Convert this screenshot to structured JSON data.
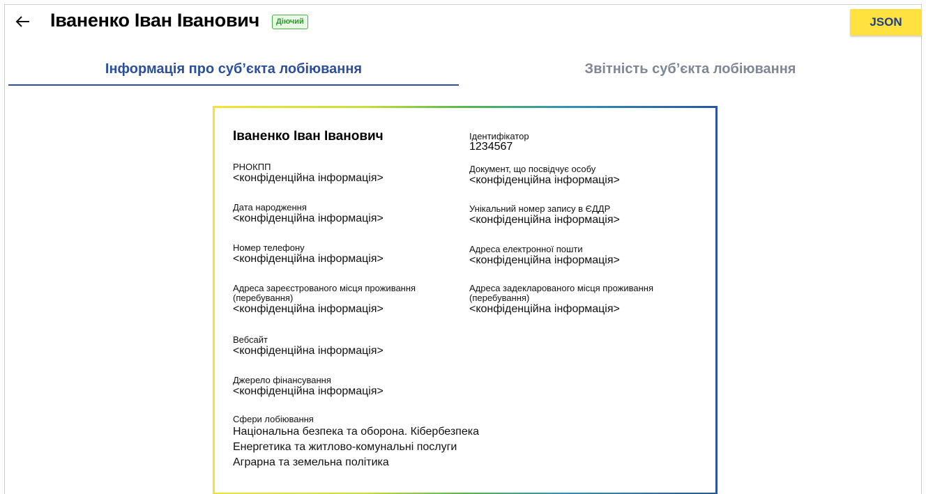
{
  "header": {
    "back_icon": "arrow-left-icon",
    "title": "Іваненко Іван Іванович",
    "status_badge": "Діючий",
    "json_button": "JSON"
  },
  "tabs": [
    {
      "label": "Інформація про суб’єкта лобіювання",
      "active": true
    },
    {
      "label": "Звітність суб’єкта лобіювання",
      "active": false
    }
  ],
  "colors": {
    "accent_blue": "#2b4f9e",
    "badge_green": "#46b33f",
    "json_button_bg": "#ffe23f",
    "inactive_tab": "#7d8795"
  },
  "card": {
    "name": "Іваненко Іван Іванович",
    "left_fields": [
      {
        "label": "РНОКПП",
        "value": "<конфіденційна інформація>"
      },
      {
        "label": "Дата народження",
        "value": "<конфіденційна інформація>"
      },
      {
        "label": "Номер телефону",
        "value": "<конфіденційна інформація>"
      },
      {
        "label": "Адреса зареєстрованого місця проживання (перебування)",
        "value": "<конфіденційна інформація>"
      },
      {
        "label": "Вебсайт",
        "value": "<конфіденційна інформація>"
      },
      {
        "label": "Джерело фінансування",
        "value": "<конфіденційна інформація>"
      }
    ],
    "right_fields": [
      {
        "label": "Ідентифікатор",
        "value": "1234567"
      },
      {
        "label": "Документ, що посвідчує особу",
        "value": "<конфіденційна інформація>"
      },
      {
        "label": "Унікальний номер запису в ЄДДР",
        "value": "<конфіденційна інформація>"
      },
      {
        "label": "Адреса електронної пошти",
        "value": "<конфіденційна інформація>"
      },
      {
        "label": "Адреса задекларованого місця проживання (перебування)",
        "value": "<конфіденційна інформація>"
      }
    ],
    "spheres_label": "Сфери лобіювання",
    "spheres": [
      "Національна безпека та оборона. Кібербезпека",
      "Енергетика та житлово-комунальні послуги",
      "Аграрна та земельна політика"
    ]
  }
}
